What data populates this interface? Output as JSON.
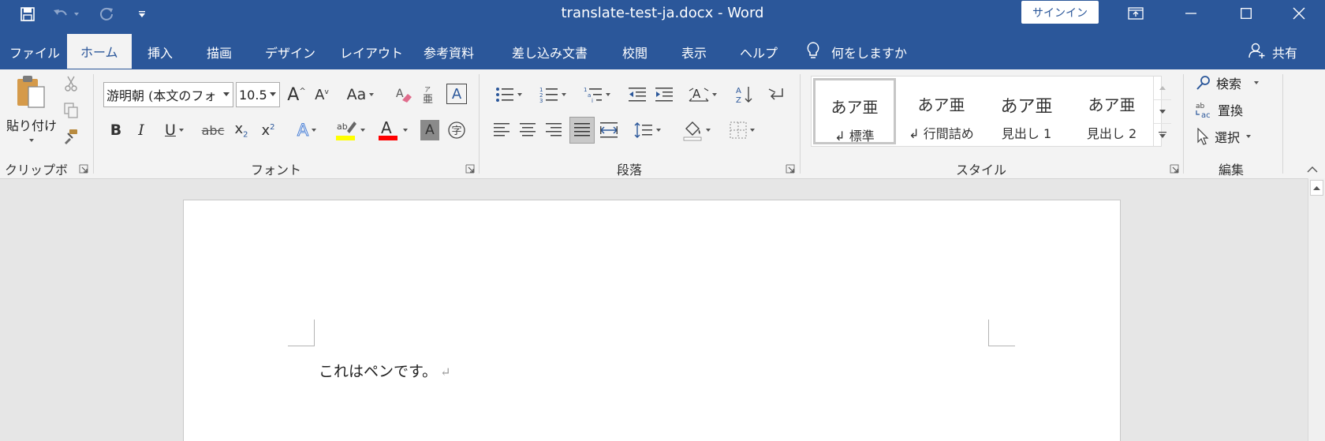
{
  "window": {
    "title": "translate-test-ja.docx  -  Word",
    "signin_label": "サインイン"
  },
  "qat": {
    "icons": [
      "save-icon",
      "undo-icon",
      "redo-icon",
      "customize-qat-icon"
    ]
  },
  "tabs": [
    {
      "label": "ファイル"
    },
    {
      "label": "ホーム"
    },
    {
      "label": "挿入"
    },
    {
      "label": "描画"
    },
    {
      "label": "デザイン"
    },
    {
      "label": "レイアウト"
    },
    {
      "label": "参考資料"
    },
    {
      "label": "差し込み文書"
    },
    {
      "label": "校閲"
    },
    {
      "label": "表示"
    },
    {
      "label": "ヘルプ"
    }
  ],
  "active_tab": "ホーム",
  "tell_me": {
    "label": "何をしますか",
    "icon": "lightbulb-icon"
  },
  "share": {
    "label": "共有",
    "icon": "person-add-icon"
  },
  "ribbon": {
    "clipboard": {
      "label": "クリップボード",
      "paste_label": "貼り付け"
    },
    "font": {
      "label": "フォント",
      "font_name": "游明朝 (本文のフォ",
      "font_size": "10.5"
    },
    "paragraph": {
      "label": "段落"
    },
    "styles": {
      "label": "スタイル",
      "items": [
        {
          "preview": "あア亜",
          "name": "↲ 標準",
          "selected": true
        },
        {
          "preview": "あア亜",
          "name": "↲ 行間詰め",
          "selected": false
        },
        {
          "preview": "あア亜",
          "name": "見出し 1",
          "selected": false
        },
        {
          "preview": "あア亜",
          "name": "見出し 2",
          "selected": false
        }
      ]
    },
    "editing": {
      "label": "編集",
      "find_label": "検索",
      "replace_label": "置換",
      "select_label": "選択"
    }
  },
  "colors": {
    "title_bar": "#2b579a",
    "highlight_color": "#ffff00",
    "font_color": "#ff0000"
  },
  "document": {
    "text": "これはペンです。",
    "paragraph_mark": "↵"
  }
}
